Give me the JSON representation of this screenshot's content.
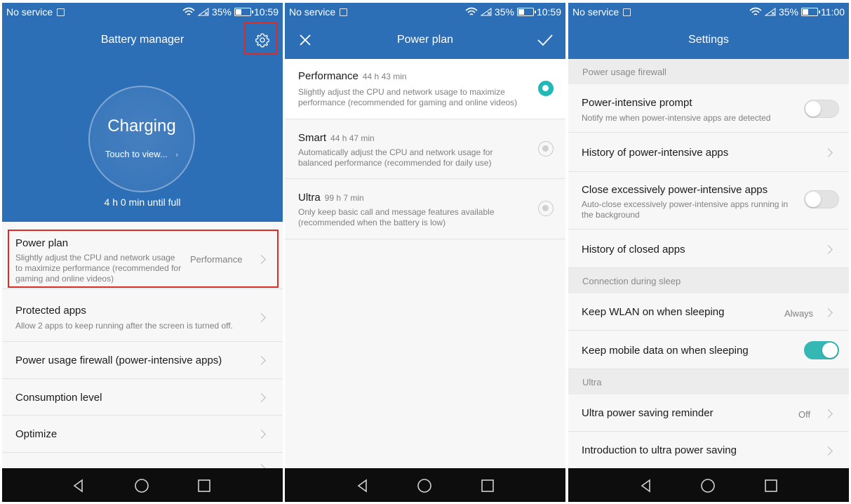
{
  "status": {
    "carrier": "No service",
    "battery_pct": "35%",
    "battery_level": 0.35,
    "times": [
      "10:59",
      "10:59",
      "11:00"
    ]
  },
  "colors": {
    "appbar": "#2d6fb7",
    "accent": "#22b8b8",
    "highlight": "#e02b24"
  },
  "battery_manager": {
    "title": "Battery manager",
    "settings_icon": "gear-icon",
    "charging": "Charging",
    "touch_to_view": "Touch to view...",
    "until_full": "4 h 0 min until full",
    "items": [
      {
        "title": "Power plan",
        "desc": "Slightly adjust the CPU and network usage to maximize performance (recommended for gaming and online videos)",
        "value": "Performance"
      },
      {
        "title": "Protected apps",
        "desc": "Allow 2 apps to keep running after the screen is turned off."
      },
      {
        "title": "Power usage firewall (power-intensive apps)"
      },
      {
        "title": "Consumption level"
      },
      {
        "title": "Optimize"
      }
    ]
  },
  "power_plan": {
    "title": "Power plan",
    "close_icon": "close-icon",
    "confirm_icon": "checkmark-icon",
    "plans": [
      {
        "name": "Performance",
        "time": "44 h 43 min",
        "desc": "Slightly adjust the CPU and network usage to maximize performance (recommended for gaming and online videos)",
        "selected": true
      },
      {
        "name": "Smart",
        "time": "44 h 47 min",
        "desc": "Automatically adjust the CPU and network usage for balanced performance (recommended for daily use)",
        "selected": false
      },
      {
        "name": "Ultra",
        "time": "99 h 7 min",
        "desc": "Only keep basic call and message features available (recommended when the battery is low)",
        "selected": false
      }
    ]
  },
  "settings": {
    "title": "Settings",
    "section_firewall": "Power usage firewall",
    "power_intensive_prompt": {
      "title": "Power-intensive prompt",
      "desc": "Notify me when power-intensive apps are detected",
      "on": false
    },
    "history_power_intensive": "History of power-intensive apps",
    "close_excessive": {
      "title": "Close excessively power-intensive apps",
      "desc": "Auto-close excessively power-intensive apps running in the background",
      "on": false
    },
    "history_closed": "History of closed apps",
    "section_sleep": "Connection during sleep",
    "keep_wlan": {
      "title": "Keep WLAN on when sleeping",
      "value": "Always"
    },
    "keep_mobile_data": {
      "title": "Keep mobile data on when sleeping",
      "on": true
    },
    "section_ultra": "Ultra",
    "ultra_reminder": {
      "title": "Ultra power saving reminder",
      "value": "Off"
    },
    "intro_ultra": "Introduction to ultra power saving"
  },
  "navbar": {
    "back_icon": "back-triangle-icon",
    "home_icon": "home-circle-icon",
    "recents_icon": "recents-square-icon"
  }
}
